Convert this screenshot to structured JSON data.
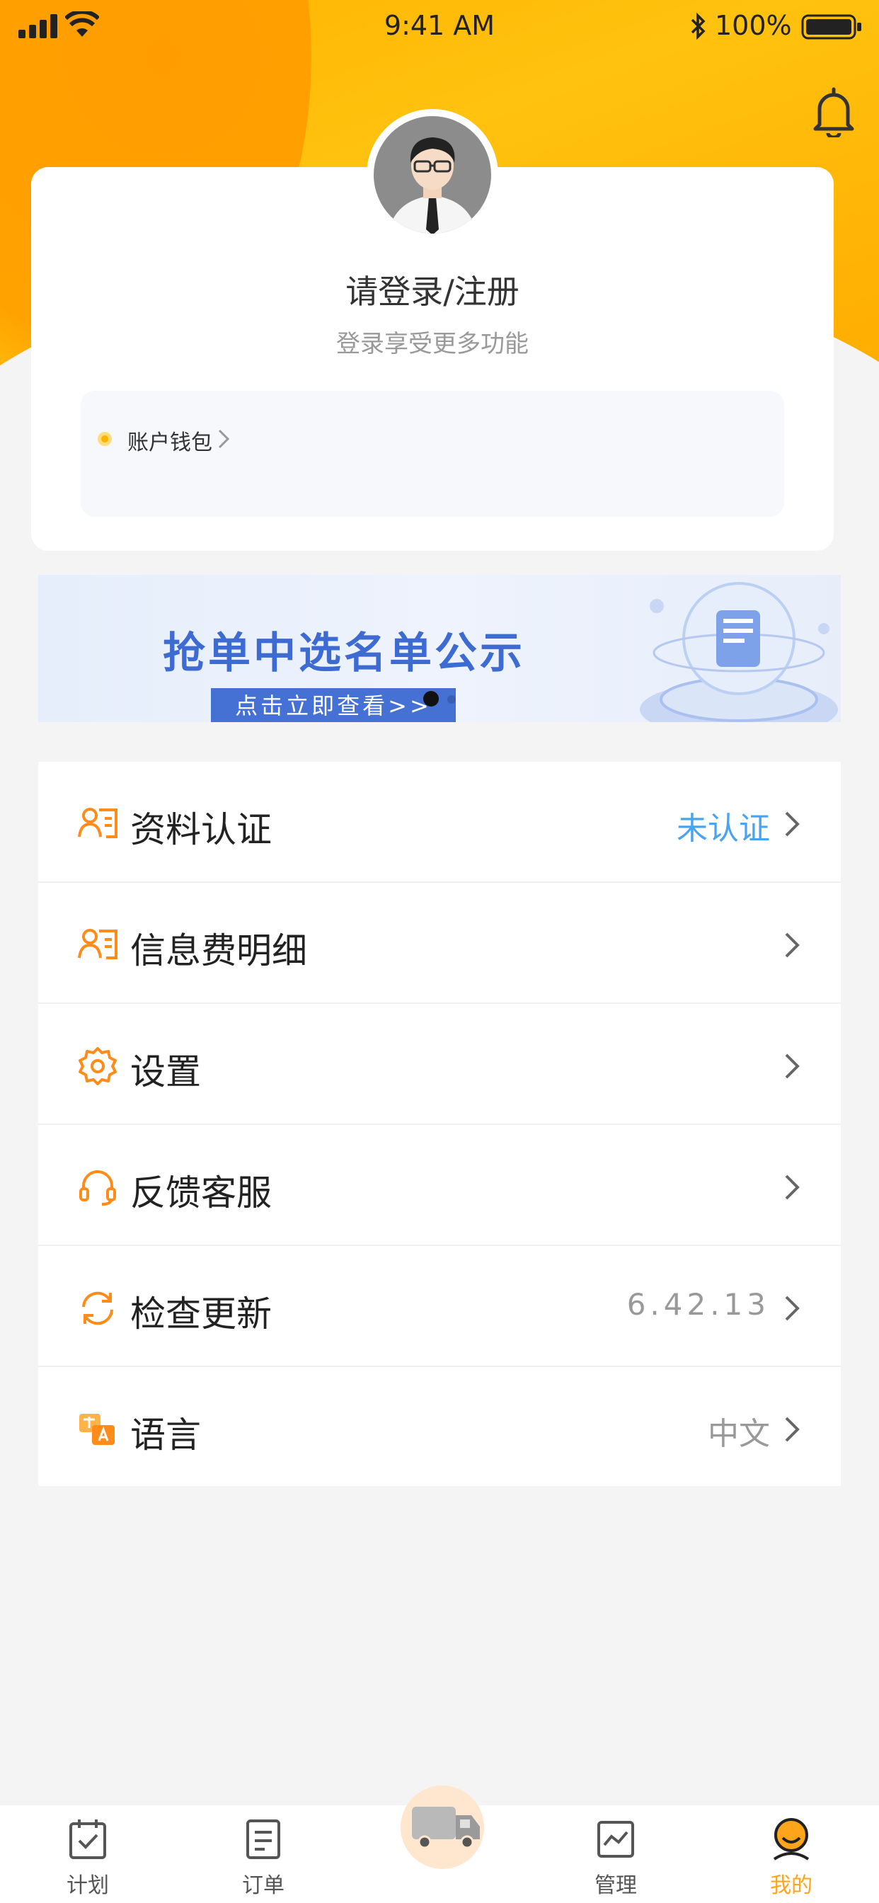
{
  "status_bar": {
    "time": "9:41 AM",
    "battery": "100%"
  },
  "profile": {
    "title": "请登录/注册",
    "subtitle": "登录享受更多功能",
    "wallet_label": "账户钱包"
  },
  "banner": {
    "title": "抢单中选名单公示",
    "button": "点击立即查看>>"
  },
  "menu": [
    {
      "label": "资料认证",
      "value": "未认证",
      "icon": "id-card-icon"
    },
    {
      "label": "信息费明细",
      "value": "",
      "icon": "id-card-icon"
    },
    {
      "label": "设置",
      "value": "",
      "icon": "gear-icon"
    },
    {
      "label": "反馈客服",
      "value": "",
      "icon": "headset-icon"
    },
    {
      "label": "检查更新",
      "value": "6.42.13",
      "icon": "refresh-icon"
    },
    {
      "label": "语言",
      "value": "中文",
      "icon": "translate-icon"
    }
  ],
  "tabs": [
    {
      "label": "计划",
      "icon": "calendar-check-icon"
    },
    {
      "label": "订单",
      "icon": "document-icon"
    },
    {
      "label": "",
      "icon": "truck-icon"
    },
    {
      "label": "管理",
      "icon": "chart-icon"
    },
    {
      "label": "我的",
      "icon": "user-icon"
    }
  ],
  "colors": {
    "accent": "#ffa51b",
    "header": "#ffc20f",
    "link_blue": "#4aa3ee",
    "banner_blue": "#3d6bd2"
  }
}
